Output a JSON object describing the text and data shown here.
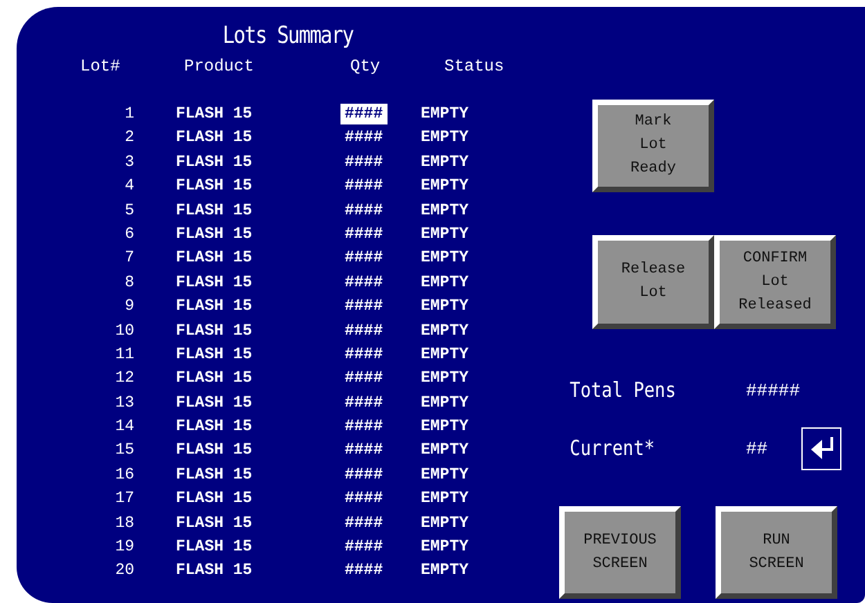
{
  "title": "Lots Summary",
  "columns": [
    "Lot#",
    "Product",
    "Qty",
    "Status"
  ],
  "rows": [
    {
      "lot": "1",
      "product": "FLASH 15",
      "qty": "####",
      "status": "EMPTY",
      "selected": true
    },
    {
      "lot": "2",
      "product": "FLASH 15",
      "qty": "####",
      "status": "EMPTY",
      "selected": false
    },
    {
      "lot": "3",
      "product": "FLASH 15",
      "qty": "####",
      "status": "EMPTY",
      "selected": false
    },
    {
      "lot": "4",
      "product": "FLASH 15",
      "qty": "####",
      "status": "EMPTY",
      "selected": false
    },
    {
      "lot": "5",
      "product": "FLASH 15",
      "qty": "####",
      "status": "EMPTY",
      "selected": false
    },
    {
      "lot": "6",
      "product": "FLASH 15",
      "qty": "####",
      "status": "EMPTY",
      "selected": false
    },
    {
      "lot": "7",
      "product": "FLASH 15",
      "qty": "####",
      "status": "EMPTY",
      "selected": false
    },
    {
      "lot": "8",
      "product": "FLASH 15",
      "qty": "####",
      "status": "EMPTY",
      "selected": false
    },
    {
      "lot": "9",
      "product": "FLASH 15",
      "qty": "####",
      "status": "EMPTY",
      "selected": false
    },
    {
      "lot": "10",
      "product": "FLASH 15",
      "qty": "####",
      "status": "EMPTY",
      "selected": false
    },
    {
      "lot": "11",
      "product": "FLASH 15",
      "qty": "####",
      "status": "EMPTY",
      "selected": false
    },
    {
      "lot": "12",
      "product": "FLASH 15",
      "qty": "####",
      "status": "EMPTY",
      "selected": false
    },
    {
      "lot": "13",
      "product": "FLASH 15",
      "qty": "####",
      "status": "EMPTY",
      "selected": false
    },
    {
      "lot": "14",
      "product": "FLASH 15",
      "qty": "####",
      "status": "EMPTY",
      "selected": false
    },
    {
      "lot": "15",
      "product": "FLASH 15",
      "qty": "####",
      "status": "EMPTY",
      "selected": false
    },
    {
      "lot": "16",
      "product": "FLASH 15",
      "qty": "####",
      "status": "EMPTY",
      "selected": false
    },
    {
      "lot": "17",
      "product": "FLASH 15",
      "qty": "####",
      "status": "EMPTY",
      "selected": false
    },
    {
      "lot": "18",
      "product": "FLASH 15",
      "qty": "####",
      "status": "EMPTY",
      "selected": false
    },
    {
      "lot": "19",
      "product": "FLASH 15",
      "qty": "####",
      "status": "EMPTY",
      "selected": false
    },
    {
      "lot": "20",
      "product": "FLASH 15",
      "qty": "####",
      "status": "EMPTY",
      "selected": false
    }
  ],
  "mark_button": {
    "lines": [
      "Mark",
      "Lot",
      "Ready"
    ]
  },
  "release_buttons": [
    {
      "lines": [
        "Release",
        "Lot"
      ]
    },
    {
      "lines": [
        "CONFIRM",
        "Lot",
        "Released"
      ]
    }
  ],
  "counters": [
    {
      "label": "Total Pens",
      "value": "#####",
      "kind": "plain"
    },
    {
      "label": "Current*",
      "value": "##",
      "kind": "entry"
    }
  ],
  "nav_buttons": [
    {
      "lines": [
        "PREVIOUS",
        "SCREEN"
      ]
    },
    {
      "lines": [
        "RUN",
        "SCREEN"
      ]
    }
  ]
}
